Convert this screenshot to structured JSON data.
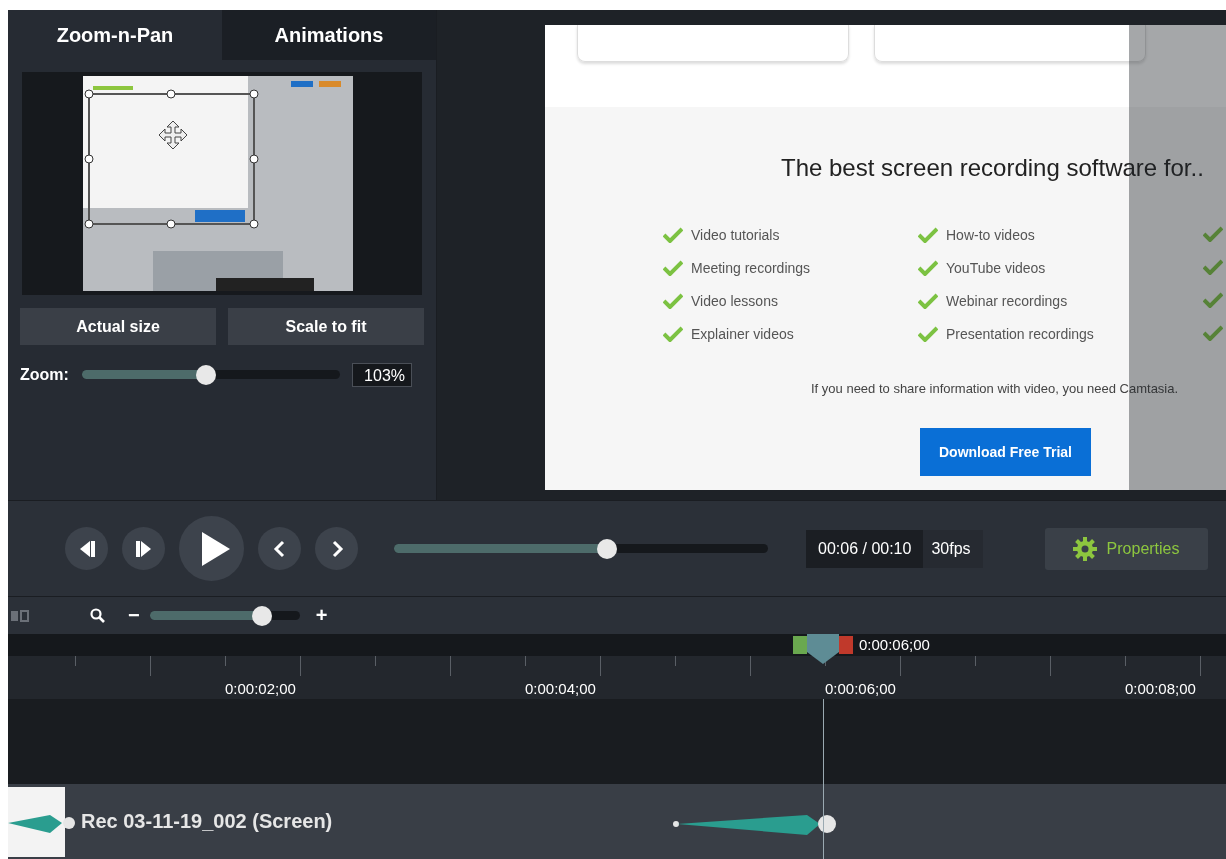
{
  "tabs": [
    {
      "label": "Zoom-n-Pan",
      "selected": true
    },
    {
      "label": "Animations",
      "selected": false
    }
  ],
  "zoom_panel": {
    "buttons": [
      "Actual size",
      "Scale to fit"
    ],
    "zoom_label": "Zoom:",
    "zoom_slider": {
      "level": 0.48
    },
    "zoom_value": "103%"
  },
  "preview": {
    "heading": "The best screen recording software for..",
    "list_left": [
      "Video tutorials",
      "Meeting recordings",
      "Video lessons",
      "Explainer videos"
    ],
    "list_right": [
      "How-to videos",
      "YouTube videos",
      "Webinar recordings",
      "Presentation recordings"
    ],
    "note": "If you need to share information with video, you need Camtasia.",
    "button": "Download Free Trial"
  },
  "playback": {
    "scrubber": {
      "level": 0.57
    },
    "time": "00:06 / 00:10",
    "fps": "30fps",
    "properties_button": "Properties"
  },
  "timeline": {
    "zoom_minus": "−",
    "zoom_plus": "+",
    "zoom_slider": {
      "level": 0.75
    },
    "playhead_time": "0:00:06;00",
    "ruler_labels": [
      "0:00:02;00",
      "0:00:04;00",
      "0:00:06;00",
      "0:00:08;00"
    ],
    "clip_label": "Rec 03-11-19_002 (Screen)"
  }
}
